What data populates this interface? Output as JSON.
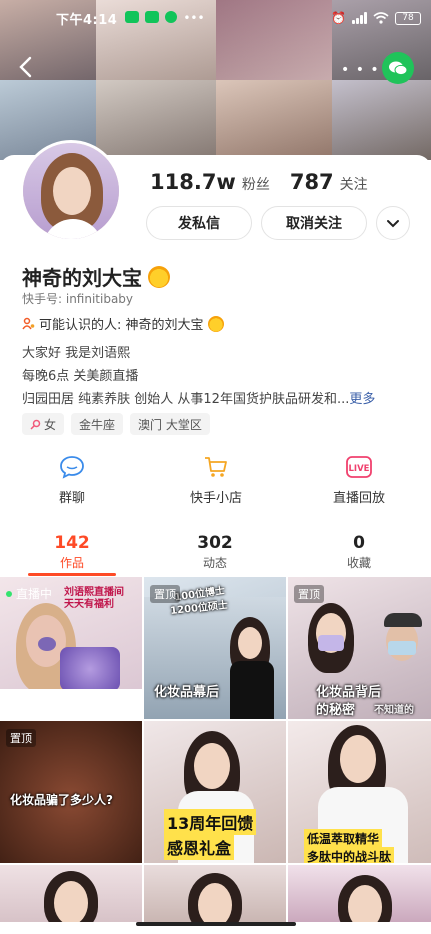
{
  "status_bar": {
    "time": "下午4:14",
    "battery": "78"
  },
  "profile": {
    "followers_count": "118.7w",
    "followers_label": "粉丝",
    "following_count": "787",
    "following_label": "关注",
    "message_button": "发私信",
    "unfollow_button": "取消关注",
    "name": "神奇的刘大宝",
    "kuaishou_id": "快手号: infinitibaby",
    "maybe_known": "可能认识的人: 神奇的刘大宝",
    "bio_lines": [
      "大家好 我是刘语熙",
      "每晚6点 关美颜直播",
      "归园田居  纯素养肤  创始人  从事12年国货护肤品研发和..."
    ],
    "more_label": "更多",
    "tags": [
      "女",
      "金牛座",
      "澳门 大堂区"
    ]
  },
  "features": [
    {
      "label": "群聊",
      "icon": "chat-bubble-icon"
    },
    {
      "label": "快手小店",
      "icon": "shopping-cart-icon"
    },
    {
      "label": "直播回放",
      "icon": "live-replay-icon"
    }
  ],
  "tabs": [
    {
      "num": "142",
      "label": "作品",
      "active": true
    },
    {
      "num": "302",
      "label": "动态",
      "active": false
    },
    {
      "num": "0",
      "label": "收藏",
      "active": false
    }
  ],
  "grid": {
    "live_badge": "直播中",
    "pinned_badge": "置顶",
    "tile1_text": "刘语熙直播间 天天有福利",
    "tile2_caption": "化妆品幕后",
    "tile2_top_lines": [
      "100位博士",
      "1200位硕士"
    ],
    "tile3_caption_lines": [
      "化妆品背后",
      "的秘密"
    ],
    "tile3_overlay": "不知道的",
    "tile4_caption": "化妆品骗了多少人?",
    "tile5_caption_lines": [
      "13周年回馈",
      "感恩礼盒"
    ],
    "tile6_caption_lines": [
      "低温萃取精华",
      "多肽中的战斗肽"
    ]
  }
}
